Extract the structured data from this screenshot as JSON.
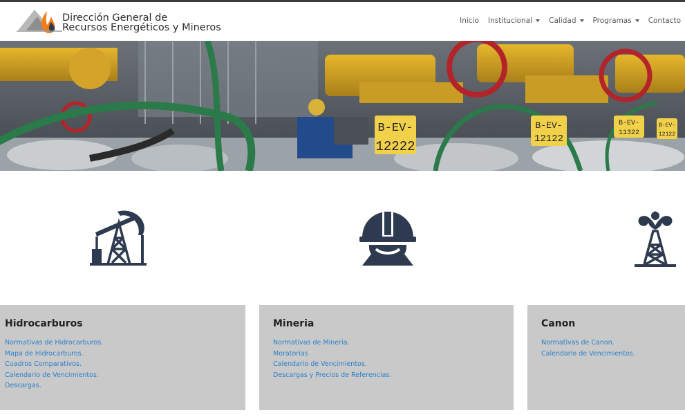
{
  "header": {
    "logo_line1": "Dirección General de",
    "logo_line2": "Recursos  Energéticos y Mineros",
    "nav": [
      {
        "label": "Inicio",
        "dropdown": false
      },
      {
        "label": "Institucional",
        "dropdown": true
      },
      {
        "label": "Calidad",
        "dropdown": true
      },
      {
        "label": "Programas",
        "dropdown": true
      },
      {
        "label": "Contacto",
        "dropdown": false
      }
    ]
  },
  "hero": {
    "plates": [
      "B-EV-",
      "12222",
      "B-EV-",
      "12122",
      "B-EV-",
      "11322",
      "B-EV-",
      "12122"
    ]
  },
  "sections": [
    {
      "icon": "oil-pumpjack-icon",
      "title": "Hidrocarburos",
      "links": [
        "Normativas de Hidrocarburos.",
        "Mapa de Hidrocarburos.",
        "Cuadros Comparativos.",
        "Calendario de Vencimientos.",
        "Descargas."
      ]
    },
    {
      "icon": "miner-helmet-icon",
      "title": "Mineria",
      "links": [
        "Normativas de Mineria.",
        "Moratorias",
        "Calendario de Vencimientos.",
        "Descargas y Precios de Referencias."
      ]
    },
    {
      "icon": "oil-derrick-gusher-icon",
      "title": "Canon",
      "links": [
        "Normativas de Canon.",
        "Calendario de Vencimientos."
      ]
    }
  ],
  "colors": {
    "icon": "#2d3a4f",
    "card_bg": "#c9c9c9",
    "link": "#2a7fc9",
    "flame": "#f07d1a"
  }
}
